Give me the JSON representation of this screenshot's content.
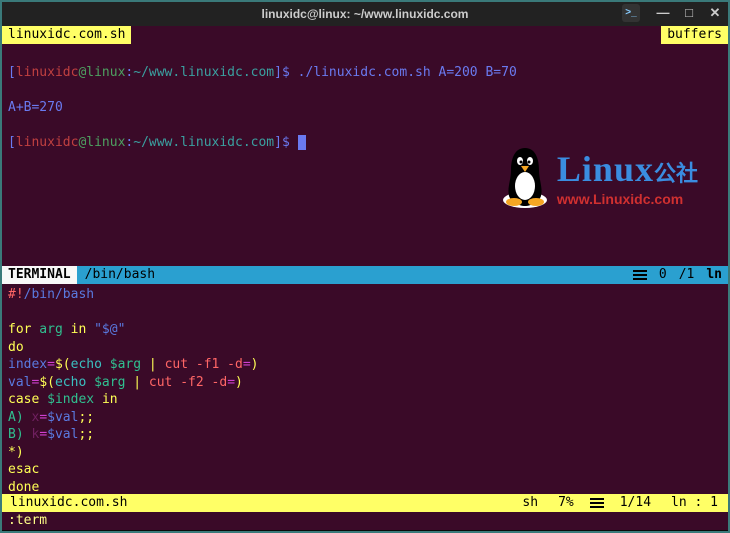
{
  "window": {
    "title": "linuxidc@linux: ~/www.linuxidc.com"
  },
  "tabs": {
    "left": " linuxidc.com.sh ",
    "right": " buffers "
  },
  "prompt": {
    "lb": "[",
    "user": "linuxidc",
    "at": "@",
    "host": "linux",
    "colon": ":",
    "path": "~/www.linuxidc.com",
    "rb": "]",
    "dollar": "$ ",
    "cmd": "./linuxidc.com.sh A=200 B=70",
    "output": "A+B=270"
  },
  "logo": {
    "big": "Linux",
    "kai": "公社",
    "url": "www.Linuxidc.com"
  },
  "midbar": {
    "tag": " TERMINAL ",
    "path": "/bin/bash",
    "pos": "0",
    "total": "/1",
    "ln": "ln"
  },
  "code": {
    "l1_a": "#!",
    "l1_b": "/bin/bash",
    "l3_a": "for",
    "l3_b": " arg ",
    "l3_c": "in",
    "l3_d": " \"$@\"",
    "l4": "do",
    "l5_a": "index",
    "l5_b": "=",
    "l5_c": "$(",
    "l5_d": "echo",
    "l5_e": " $arg ",
    "l5_f": "| ",
    "l5_g": "cut -f1 -d",
    "l5_h": "=",
    "l5_i": ")",
    "l6_a": "val",
    "l6_b": "=",
    "l6_c": "$(",
    "l6_d": "echo",
    "l6_e": " $arg ",
    "l6_f": "| ",
    "l6_g": "cut -f2 -d",
    "l6_h": "=",
    "l6_i": ")",
    "l7_a": "case",
    "l7_b": " $index ",
    "l7_c": "in",
    "l8_a": "A) ",
    "l8_b": "x",
    "l8_c": "=",
    "l8_d": "$val",
    "l8_e": ";;",
    "l9_a": "B) ",
    "l9_b": "k",
    "l9_c": "=",
    "l9_d": "$val",
    "l9_e": ";;",
    "l10": "*)",
    "l11": "esac",
    "l12": "done"
  },
  "botbar": {
    "fname": "linuxidc.com.sh",
    "ft": "sh",
    "pct": "7%",
    "lines": "1/14",
    "lncol": "ln :   1"
  },
  "cmdline": ":term"
}
